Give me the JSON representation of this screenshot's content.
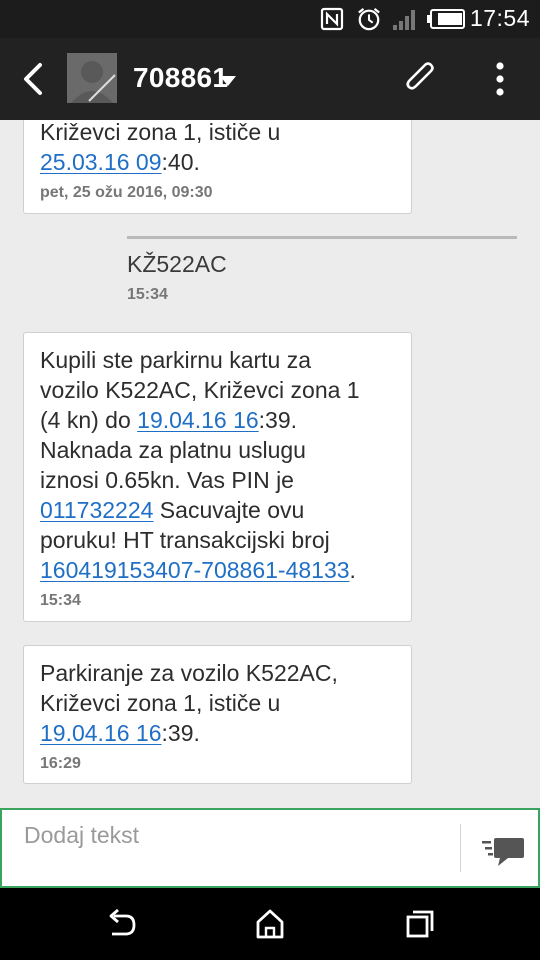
{
  "status_bar": {
    "time": "17:54",
    "icons": [
      "nfc-icon",
      "alarm-icon",
      "signal-icon",
      "battery-icon"
    ]
  },
  "app_bar": {
    "back_icon": "back-arrow-icon",
    "contact_name": "708861",
    "dropdown_icon": "caret-down-icon",
    "attach_icon": "paperclip-icon",
    "menu_icon": "overflow-menu-icon"
  },
  "messages": [
    {
      "type": "received",
      "text_before": "Križevci zona 1, ističe u",
      "link": "25.03.16 09",
      "text_after": ":40.",
      "meta": "pet, 25 ožu 2016, 09:30"
    },
    {
      "type": "sent",
      "text": "KŽ522AC",
      "meta": "15:34"
    },
    {
      "type": "received",
      "line1": "Kupili ste parkirnu kartu za",
      "line2": "vozilo K522AC, Križevci zona 1",
      "line3_before": "(4 kn) do ",
      "line3_link": "19.04.16 16",
      "line3_after": ":39.",
      "line4": "Naknada za platnu uslugu",
      "line5": "iznosi 0.65kn. Vas PIN je",
      "line6_link": "011732224",
      "line6_after": " Sacuvajte ovu",
      "line7": "poruku! HT transakcijski broj",
      "line8_link": "160419153407-708861-48133",
      "line8_after": ".",
      "meta": "15:34"
    },
    {
      "type": "received",
      "line1": "Parkiranje za vozilo K522AC,",
      "line2": "Križevci zona 1, ističe u",
      "line3_link": "19.04.16 16",
      "line3_after": ":39.",
      "meta": "16:29"
    }
  ],
  "composer": {
    "placeholder": "Dodaj tekst",
    "send_icon": "send-message-icon"
  },
  "nav_bar": {
    "icons": [
      "back-nav-icon",
      "home-icon",
      "recent-apps-icon"
    ]
  },
  "colors": {
    "link": "#1f6fc7",
    "app_bar": "#222222",
    "composer_border": "#3aa35e",
    "background": "#ececec"
  }
}
